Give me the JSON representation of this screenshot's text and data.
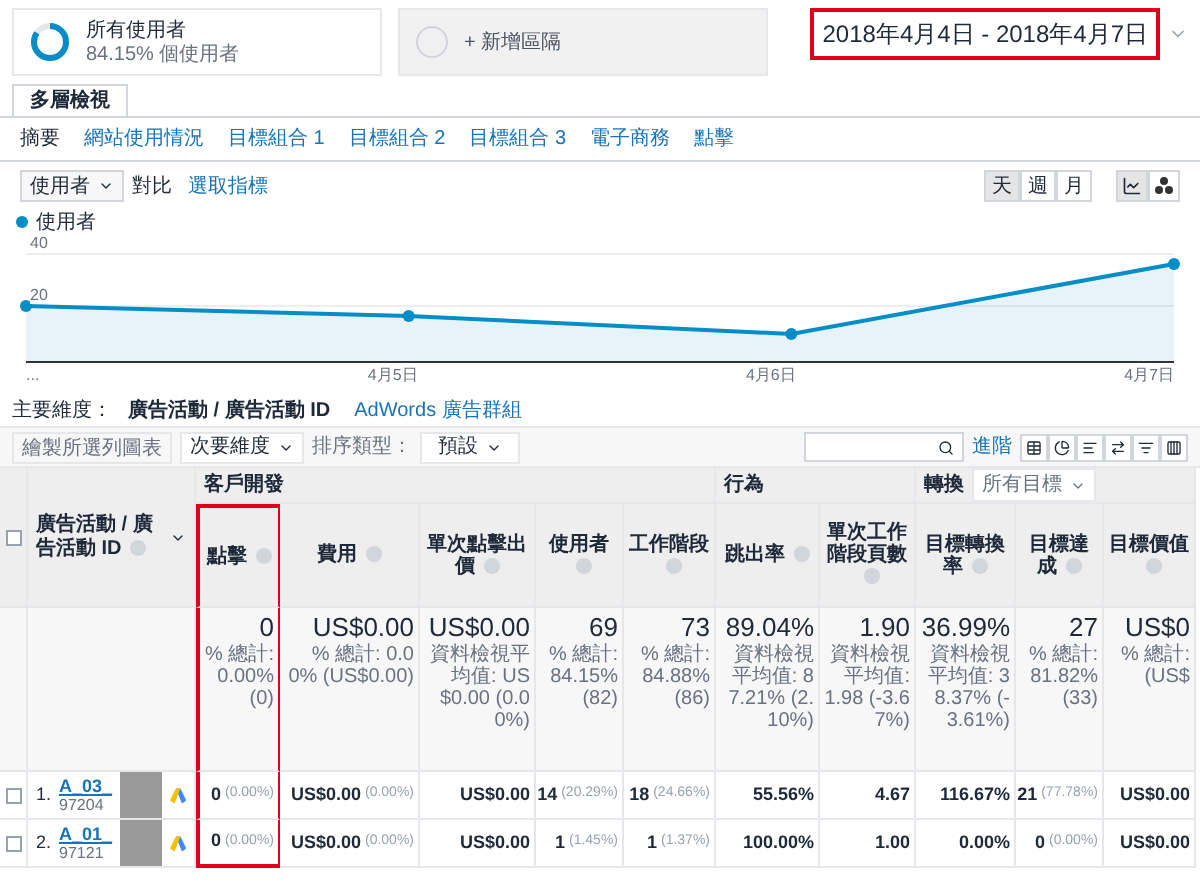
{
  "segments": [
    {
      "kind": "active",
      "title": "所有使用者",
      "subtitle": "84.15% 個使用者"
    },
    {
      "kind": "add",
      "title": "+ 新增區隔"
    }
  ],
  "date_range": {
    "text": "2018年4月4日 - 2018年4月7日",
    "highlighted": true
  },
  "tabs": [
    {
      "label": "多層檢視",
      "selected": true
    }
  ],
  "report_links": [
    {
      "label": "摘要",
      "selected": true
    },
    {
      "label": "網站使用情況",
      "selected": false
    },
    {
      "label": "目標組合 1",
      "selected": false
    },
    {
      "label": "目標組合 2",
      "selected": false
    },
    {
      "label": "目標組合 3",
      "selected": false
    },
    {
      "label": "電子商務",
      "selected": false
    },
    {
      "label": "點擊",
      "selected": false
    }
  ],
  "metric_controls": {
    "metric": "使用者",
    "compare": "對比",
    "select_metric": "選取指標"
  },
  "granularity": [
    {
      "label": "天",
      "selected": true
    },
    {
      "label": "週",
      "selected": false
    },
    {
      "label": "月",
      "selected": false
    }
  ],
  "chart_types": [
    {
      "kind": "line",
      "selected": true
    },
    {
      "kind": "motion",
      "selected": false
    }
  ],
  "chart": {
    "legend": "使用者",
    "y_labels": [
      "40",
      "20"
    ],
    "x_labels": [
      "...",
      "4月5日",
      "4月6日",
      "4月7日"
    ]
  },
  "dimension": {
    "label": "主要維度：",
    "primary": "廣告活動 / 廣告活動 ID",
    "secondary": "AdWords 廣告群組"
  },
  "toolbar": {
    "plot_rows": "繪製所選列圖表",
    "secondary_dimension": "次要維度",
    "sort_label": "排序類型：",
    "sort": "預設",
    "advanced": "進階"
  },
  "table": {
    "first_column": "廣告活動 / 廣告活動 ID",
    "select_all": {
      "checked": false
    },
    "groups": [
      {
        "label": "客戶開發",
        "columns": [
          {
            "label": "點擊",
            "highlighted": true
          },
          {
            "label": "費用",
            "highlighted": false
          },
          {
            "label": "單次點擊出價",
            "highlighted": false
          },
          {
            "label": "使用者",
            "highlighted": false
          },
          {
            "label": "工作階段",
            "highlighted": false
          }
        ]
      },
      {
        "label": "行為",
        "columns": [
          {
            "label": "跳出率",
            "highlighted": false
          },
          {
            "label": "單次工作階段頁數",
            "highlighted": false
          }
        ]
      },
      {
        "label": "轉換",
        "dropdown": "所有目標",
        "columns": [
          {
            "label": "目標轉換率",
            "highlighted": false
          },
          {
            "label": "目標達成",
            "highlighted": false
          },
          {
            "label": "目標價值",
            "highlighted": false
          }
        ]
      }
    ],
    "totals": [
      {
        "value": "0",
        "note": "% 總計: 0.00% (0)"
      },
      {
        "value": "US$0.00",
        "note": "% 總計: 0.00% (US$0.00)"
      },
      {
        "value": "US$0.00",
        "note": "資料檢視平均值: US$0.00 (0.00%)"
      },
      {
        "value": "69",
        "note": "% 總計: 84.15% (82)"
      },
      {
        "value": "73",
        "note": "% 總計: 84.88% (86)"
      },
      {
        "value": "89.04%",
        "note": "資料檢視平均值: 87.21% (2.10%)"
      },
      {
        "value": "1.90",
        "note": "資料檢視平均值: 1.98 (-3.67%)"
      },
      {
        "value": "36.99%",
        "note": "資料檢視平均值: 38.37% (-3.61%)"
      },
      {
        "value": "27",
        "note": "% 總計: 81.82% (33)"
      },
      {
        "value": "US$0",
        "note": "% 總計: (US$"
      }
    ],
    "rows": [
      {
        "rank": "1.",
        "name": "A_03_",
        "id": "97204",
        "redacted": true,
        "checked": false,
        "cells": [
          {
            "value": "0",
            "pct": "(0.00%)"
          },
          {
            "value": "US$0.00",
            "pct": "(0.00%)"
          },
          {
            "value": "US$0.00"
          },
          {
            "value": "14",
            "pct": "(20.29%)"
          },
          {
            "value": "18",
            "pct": "(24.66%)"
          },
          {
            "value": "55.56%"
          },
          {
            "value": "4.67"
          },
          {
            "value": "116.67%"
          },
          {
            "value": "21",
            "pct": "(77.78%)"
          },
          {
            "value": "US$0.00"
          }
        ]
      },
      {
        "rank": "2.",
        "name": "A_01_",
        "id": "97121",
        "redacted": true,
        "checked": false,
        "cells": [
          {
            "value": "0",
            "pct": "(0.00%)"
          },
          {
            "value": "US$0.00",
            "pct": "(0.00%)"
          },
          {
            "value": "US$0.00"
          },
          {
            "value": "1",
            "pct": "(1.45%)"
          },
          {
            "value": "1",
            "pct": "(1.37%)"
          },
          {
            "value": "100.00%"
          },
          {
            "value": "1.00"
          },
          {
            "value": "0.00%"
          },
          {
            "value": "0",
            "pct": "(0.00%)"
          },
          {
            "value": "US$0.00"
          }
        ]
      }
    ]
  }
}
